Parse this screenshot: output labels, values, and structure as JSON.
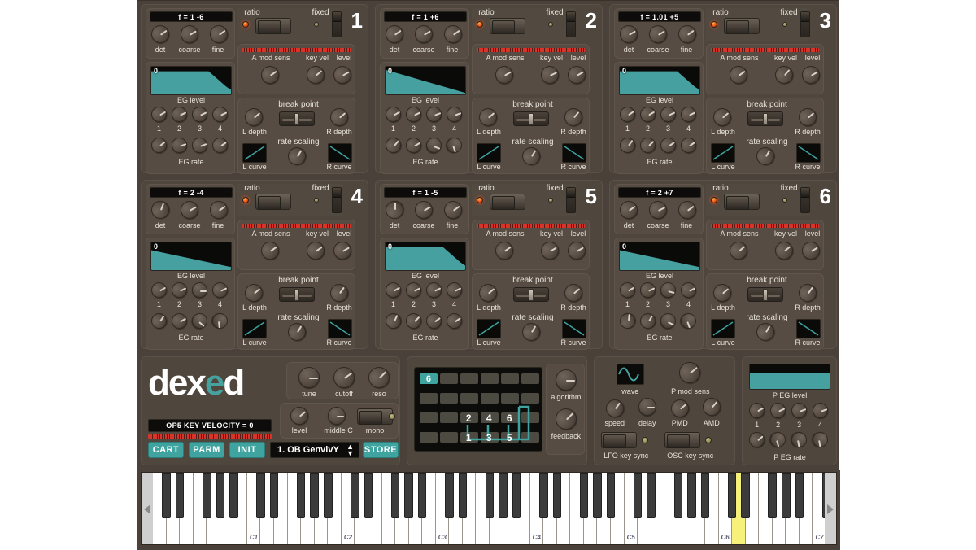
{
  "app": {
    "name": "dexed",
    "logo_white": "dex",
    "logo_teal": "e",
    "logo_white2": "d"
  },
  "colors": {
    "accent_teal": "#3fa39f",
    "panel": "#4f463d",
    "window_bg": "#4a423a",
    "lcd_bg": "#0d0c0a",
    "led_on": "#f04a10",
    "key_highlight": "#f7f07a"
  },
  "operators": [
    {
      "number": "1",
      "freq_display": "f = 1 -6",
      "ratio_label": "ratio",
      "fixed_label": "fixed",
      "ratio_led": "on",
      "fixed_led": "off",
      "det_label": "det",
      "coarse_label": "coarse",
      "fine_label": "fine",
      "eg_level_label": "EG level",
      "eg_rate_label": "EG rate",
      "eg_zero": "0",
      "eg_steps": [
        "1",
        "2",
        "3",
        "4"
      ],
      "a_mod_sens_label": "A mod sens",
      "key_vel_label": "key vel",
      "level_label": "level",
      "break_point_label": "break point",
      "l_depth_label": "L depth",
      "r_depth_label": "R depth",
      "rate_scaling_label": "rate scaling",
      "l_curve_label": "L curve",
      "r_curve_label": "R curve",
      "env_shape": "sustain-decay",
      "knobs": {
        "det": -35,
        "coarse": -30,
        "fine": -35,
        "amod": -35,
        "keyvel": -40,
        "level": -30,
        "ldepth": -40,
        "rdepth": -40,
        "ratescale": -60
      },
      "eg_level_knobs": [
        -30,
        -25,
        -25,
        -25
      ],
      "eg_rate_knobs": [
        -40,
        -20,
        -20,
        -35
      ]
    },
    {
      "number": "2",
      "freq_display": "f = 1 +6",
      "ratio_label": "ratio",
      "fixed_label": "fixed",
      "ratio_led": "on",
      "fixed_led": "off",
      "det_label": "det",
      "coarse_label": "coarse",
      "fine_label": "fine",
      "eg_level_label": "EG level",
      "eg_rate_label": "EG rate",
      "eg_zero": "0",
      "eg_steps": [
        "1",
        "2",
        "3",
        "4"
      ],
      "a_mod_sens_label": "A mod sens",
      "key_vel_label": "key vel",
      "level_label": "level",
      "break_point_label": "break point",
      "l_depth_label": "L depth",
      "r_depth_label": "R depth",
      "rate_scaling_label": "rate scaling",
      "l_curve_label": "L curve",
      "r_curve_label": "R curve",
      "env_shape": "ramp-down",
      "knobs": {
        "det": -35,
        "coarse": -30,
        "fine": -35,
        "amod": -30,
        "keyvel": -25,
        "level": -30,
        "ldepth": -40,
        "rdepth": -50,
        "ratescale": -60
      },
      "eg_level_knobs": [
        -30,
        -25,
        -20,
        -20
      ],
      "eg_rate_knobs": [
        -50,
        -30,
        20,
        70
      ]
    },
    {
      "number": "3",
      "freq_display": "f = 1.01 +5",
      "ratio_label": "ratio",
      "fixed_label": "fixed",
      "ratio_led": "on",
      "fixed_led": "off",
      "det_label": "det",
      "coarse_label": "coarse",
      "fine_label": "fine",
      "eg_level_label": "EG level",
      "eg_rate_label": "EG rate",
      "eg_zero": "0",
      "eg_steps": [
        "1",
        "2",
        "3",
        "4"
      ],
      "a_mod_sens_label": "A mod sens",
      "key_vel_label": "key vel",
      "level_label": "level",
      "break_point_label": "break point",
      "l_depth_label": "L depth",
      "r_depth_label": "R depth",
      "rate_scaling_label": "rate scaling",
      "l_curve_label": "L curve",
      "r_curve_label": "R curve",
      "env_shape": "sustain-decay",
      "knobs": {
        "det": -30,
        "coarse": -30,
        "fine": -35,
        "amod": -35,
        "keyvel": -50,
        "level": -30,
        "ldepth": -40,
        "rdepth": -40,
        "ratescale": -60
      },
      "eg_level_knobs": [
        -35,
        -30,
        -25,
        -25
      ],
      "eg_rate_knobs": [
        -55,
        -45,
        -35,
        -35
      ]
    },
    {
      "number": "4",
      "freq_display": "f = 2 -4",
      "ratio_label": "ratio",
      "fixed_label": "fixed",
      "ratio_led": "on",
      "fixed_led": "off",
      "det_label": "det",
      "coarse_label": "coarse",
      "fine_label": "fine",
      "eg_level_label": "EG level",
      "eg_rate_label": "EG rate",
      "eg_zero": "0",
      "eg_steps": [
        "1",
        "2",
        "3",
        "4"
      ],
      "a_mod_sens_label": "A mod sens",
      "key_vel_label": "key vel",
      "level_label": "level",
      "break_point_label": "break point",
      "l_depth_label": "L depth",
      "r_depth_label": "R depth",
      "rate_scaling_label": "rate scaling",
      "l_curve_label": "L curve",
      "r_curve_label": "R curve",
      "env_shape": "ramp-down-low",
      "knobs": {
        "det": -70,
        "coarse": -30,
        "fine": -35,
        "amod": -35,
        "keyvel": -35,
        "level": -30,
        "ldepth": -40,
        "rdepth": -55,
        "ratescale": -60
      },
      "eg_level_knobs": [
        -30,
        -25,
        0,
        -25
      ],
      "eg_rate_knobs": [
        -55,
        -30,
        40,
        85
      ]
    },
    {
      "number": "5",
      "freq_display": "f = 1 -5",
      "ratio_label": "ratio",
      "fixed_label": "fixed",
      "ratio_led": "on",
      "fixed_led": "off",
      "det_label": "det",
      "coarse_label": "coarse",
      "fine_label": "fine",
      "eg_level_label": "EG level",
      "eg_rate_label": "EG rate",
      "eg_zero": "0",
      "eg_steps": [
        "1",
        "2",
        "3",
        "4"
      ],
      "a_mod_sens_label": "A mod sens",
      "key_vel_label": "key vel",
      "level_label": "level",
      "break_point_label": "break point",
      "l_depth_label": "L depth",
      "r_depth_label": "R depth",
      "rate_scaling_label": "rate scaling",
      "l_curve_label": "L curve",
      "r_curve_label": "R curve",
      "env_shape": "sustain-decay",
      "knobs": {
        "det": -90,
        "coarse": -30,
        "fine": -35,
        "amod": -35,
        "keyvel": -30,
        "level": -30,
        "ldepth": -40,
        "rdepth": -40,
        "ratescale": -60
      },
      "eg_level_knobs": [
        -30,
        -25,
        -25,
        -25
      ],
      "eg_rate_knobs": [
        -65,
        -45,
        -35,
        -35
      ]
    },
    {
      "number": "6",
      "freq_display": "f = 2 +7",
      "ratio_label": "ratio",
      "fixed_label": "fixed",
      "ratio_led": "on",
      "fixed_led": "off",
      "det_label": "det",
      "coarse_label": "coarse",
      "fine_label": "fine",
      "eg_level_label": "EG level",
      "eg_rate_label": "EG rate",
      "eg_zero": "0",
      "eg_steps": [
        "1",
        "2",
        "3",
        "4"
      ],
      "a_mod_sens_label": "A mod sens",
      "key_vel_label": "key vel",
      "level_label": "level",
      "break_point_label": "break point",
      "l_depth_label": "L depth",
      "r_depth_label": "R depth",
      "rate_scaling_label": "rate scaling",
      "l_curve_label": "L curve",
      "r_curve_label": "R curve",
      "env_shape": "ramp-down-low",
      "knobs": {
        "det": -35,
        "coarse": -25,
        "fine": -35,
        "amod": -40,
        "keyvel": -40,
        "level": -30,
        "ldepth": -40,
        "rdepth": -55,
        "ratescale": -60
      },
      "eg_level_knobs": [
        -30,
        -25,
        15,
        -25
      ],
      "eg_rate_knobs": [
        -85,
        -60,
        25,
        70
      ]
    }
  ],
  "main": {
    "velocity_display": "OP5 KEY VELOCITY = 0",
    "cart_label": "CART",
    "parm_label": "PARM",
    "init_label": "INIT",
    "store_label": "STORE",
    "preset_name": "1. OB GenvivY",
    "tune_label": "tune",
    "cutoff_label": "cutoff",
    "reso_label": "reso",
    "level_label": "level",
    "middle_c_label": "middle C",
    "mono_label": "mono",
    "mono_led": "off"
  },
  "algorithm": {
    "algorithm_label": "algorithm",
    "feedback_label": "feedback",
    "selected": "6",
    "top_row_ops": [
      "2",
      "4",
      "6"
    ],
    "bottom_row_ops": [
      "1",
      "3",
      "5"
    ]
  },
  "lfo": {
    "wave_label": "wave",
    "wave_shape": "sine",
    "p_mod_sens_label": "P mod sens",
    "speed_label": "speed",
    "delay_label": "delay",
    "pmd_label": "PMD",
    "amd_label": "AMD",
    "lfo_key_sync_label": "LFO key sync",
    "osc_key_sync_label": "OSC key sync",
    "lfo_key_sync_led": "off",
    "osc_key_sync_led": "off"
  },
  "pitch_eg": {
    "p_eg_level_label": "P EG level",
    "p_eg_rate_label": "P EG rate",
    "steps": [
      "1",
      "2",
      "3",
      "4"
    ],
    "level_knobs": [
      -30,
      -25,
      -20,
      -20
    ],
    "rate_knobs": [
      -40,
      75,
      80,
      80
    ]
  },
  "keyboard": {
    "octave_labels": [
      "C1",
      "C2",
      "C3",
      "C4",
      "C5",
      "C6",
      "C7"
    ],
    "highlighted_key": "D6",
    "scroll_left": "◀",
    "scroll_right": "▶"
  }
}
